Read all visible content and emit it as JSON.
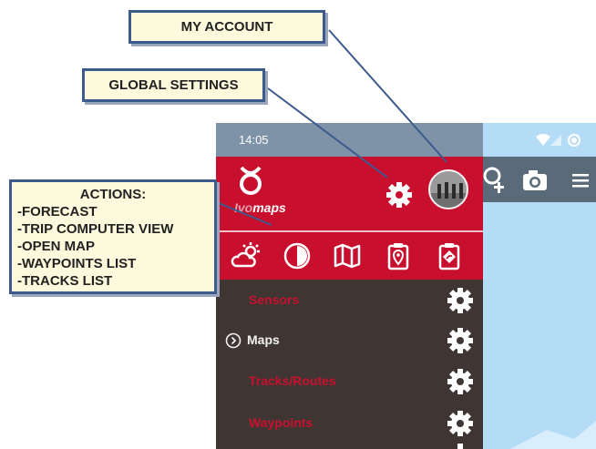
{
  "callouts": {
    "my_account": "MY ACCOUNT",
    "global_settings": "GLOBAL SETTINGS",
    "actions_title": "ACTIONS:",
    "actions_items": [
      "-FORECAST",
      "-TRIP COMPUTER VIEW",
      "-OPEN MAP",
      "-WAYPOINTS LIST",
      "-TRACKS LIST"
    ]
  },
  "status_bar": {
    "time": "14:05"
  },
  "app": {
    "logo_prefix": "Ivo",
    "logo_suffix": "maps"
  },
  "drawer": {
    "items": [
      {
        "label": "Sensors",
        "has_arrow": false
      },
      {
        "label": "Maps",
        "has_arrow": true
      },
      {
        "label": "Tracks/Routes",
        "has_arrow": false
      },
      {
        "label": "Waypoints",
        "has_arrow": false
      }
    ]
  },
  "colors": {
    "brand_red": "#c8102e",
    "drawer_bg": "#3f3633",
    "callout_border": "#3d5a8c",
    "callout_bg": "#fdf9dc"
  },
  "icons": [
    "weather-forecast-icon",
    "trip-computer-icon",
    "map-icon",
    "waypoint-list-icon",
    "track-list-icon",
    "gear-icon",
    "camera-icon",
    "menu-icon",
    "add-location-icon"
  ]
}
